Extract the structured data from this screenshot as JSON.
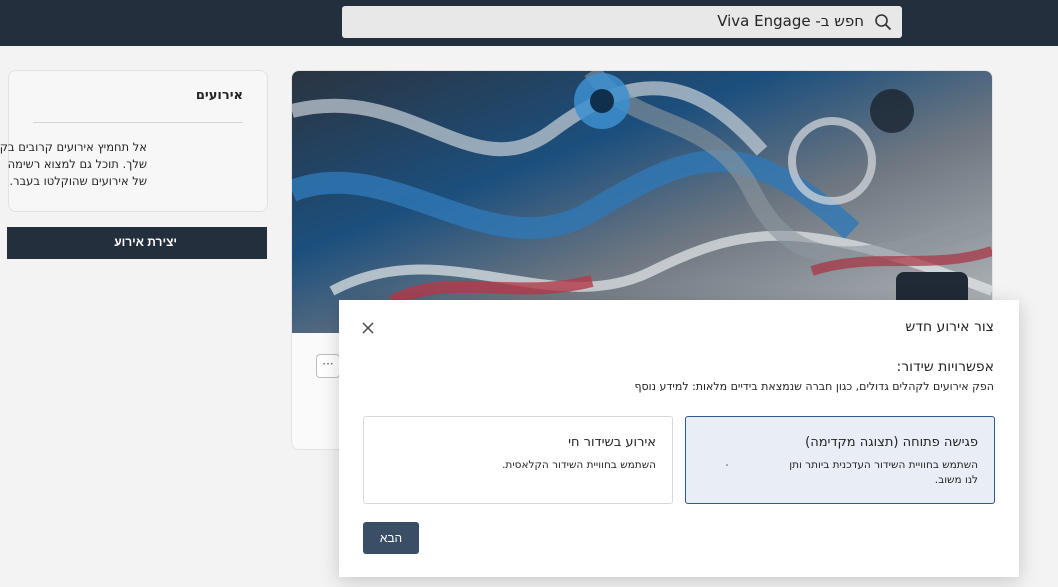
{
  "search": {
    "placeholder": "חפש ב- Viva Engage"
  },
  "events": {
    "title": "אירועים",
    "line1": "אל תחמיץ אירועים קרובים בקהילה",
    "line2": "שלך. תוכל גם למצוא רשימה",
    "line3": "של אירועים שהוקלטו בעבר.",
    "create_label": "יצירת אירוע"
  },
  "hero": {
    "more_label": "···"
  },
  "modal": {
    "title": "צור אירוע חדש",
    "broadcast_heading": "אפשרויות שידור:",
    "broadcast_desc": "הפק אירועים לקהלים גדולים, כגון חברה שנמצאת בידיים מלאות: למידע נוסף",
    "options": [
      {
        "name": "פגישה פתוחה (תצוגה מקדימה)",
        "desc_line1": "השתמש בחוויית השידור העדכנית ביותר ותן",
        "desc_line2": "לנו משוב.",
        "selected": true
      },
      {
        "name": "אירוע בשידור חי",
        "desc_line1": "השתמש בחוויית השידור הקלאסית.",
        "desc_line2": "",
        "selected": false
      }
    ],
    "next_label": "הבא"
  },
  "colors": {
    "topbar": "#232f3c",
    "accent": "#2c5a8a",
    "selected_bg": "#e9eef6"
  },
  "icons": {
    "search": "search-icon",
    "close": "close-icon"
  }
}
